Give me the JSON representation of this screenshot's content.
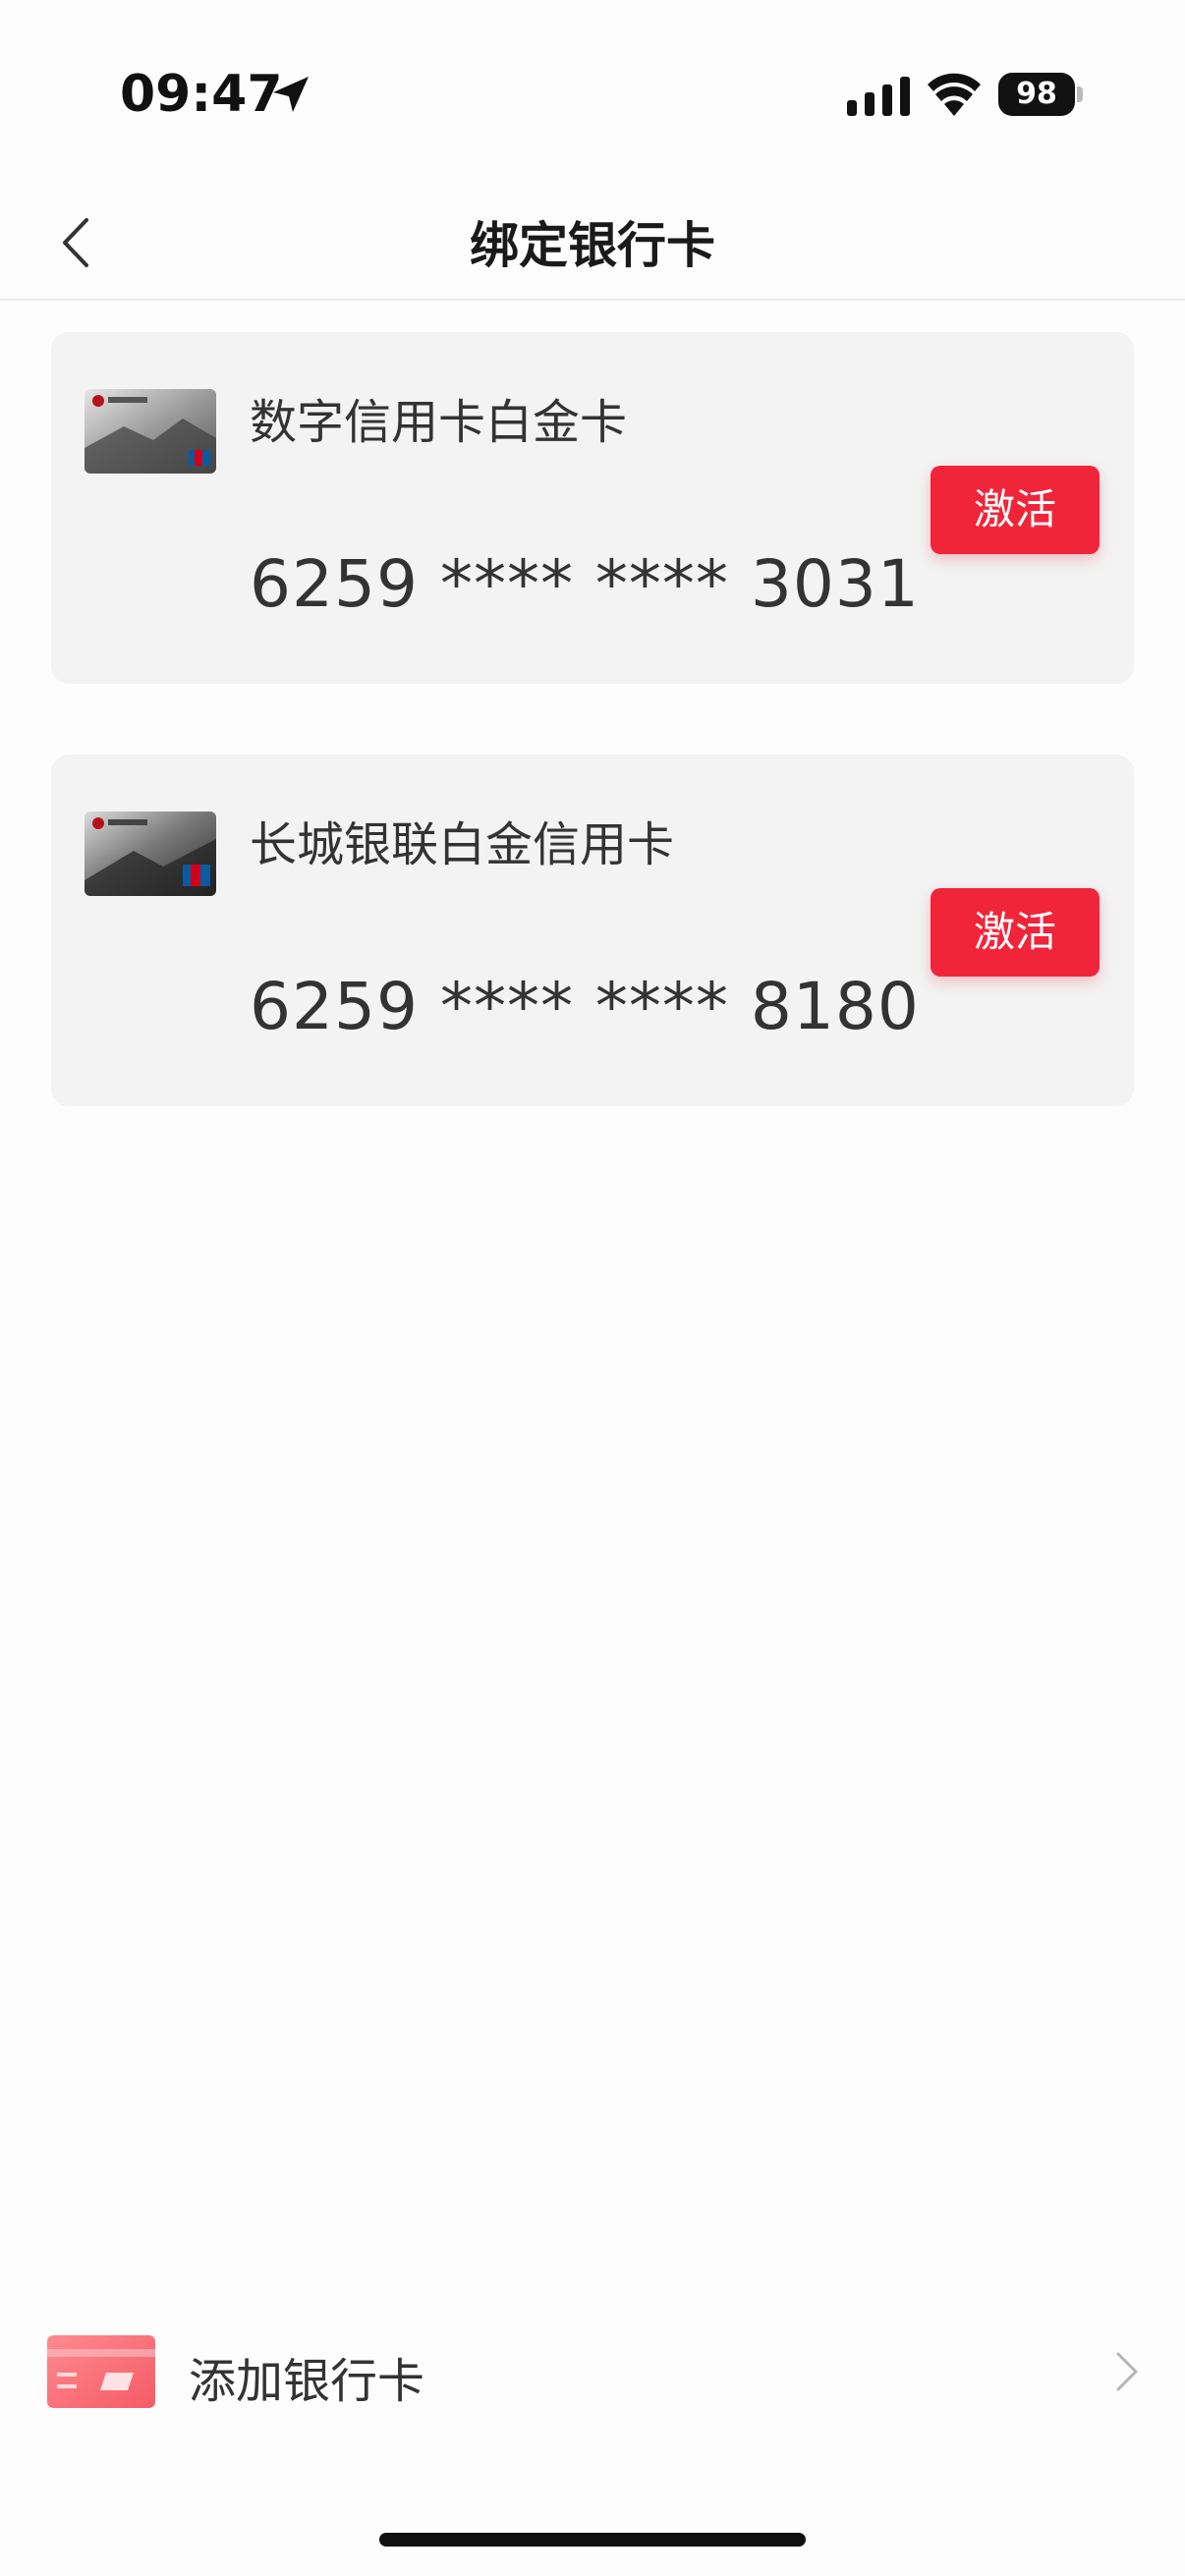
{
  "status_bar": {
    "time": "09:47",
    "battery": "98"
  },
  "nav": {
    "title": "绑定银行卡"
  },
  "cards": [
    {
      "name": "数字信用卡白金卡",
      "number": "6259 **** **** 3031",
      "action": "激活"
    },
    {
      "name": "长城银联白金信用卡",
      "number": "6259 **** **** 8180",
      "action": "激活"
    }
  ],
  "add_card": {
    "label": "添加银行卡"
  },
  "colors": {
    "accent": "#f0253a",
    "card_bg": "#f3f3f3",
    "page_bg": "#fdfdfd"
  },
  "icons": {
    "location": "location-arrow-icon",
    "signal": "cellular-signal-icon",
    "wifi": "wifi-icon",
    "back": "back-chevron-icon",
    "add_card": "bank-card-icon",
    "row_arrow": "chevron-right-icon"
  }
}
